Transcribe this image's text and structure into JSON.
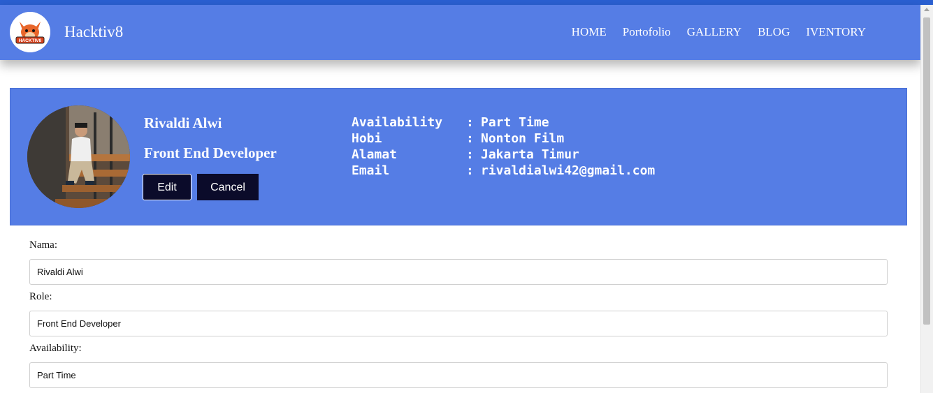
{
  "brand": {
    "name": "Hacktiv8",
    "logo_text": "HACKTIV8"
  },
  "nav": {
    "links": [
      "HOME",
      "Portofolio",
      "GALLERY",
      "BLOG",
      "IVENTORY"
    ]
  },
  "profile": {
    "name": "Rivaldi Alwi",
    "role": "Front End Developer",
    "edit_label": "Edit",
    "cancel_label": "Cancel",
    "details": [
      {
        "label": "Availability",
        "sep": ":",
        "value": "Part Time"
      },
      {
        "label": "Hobi",
        "sep": ":",
        "value": "Nonton Film"
      },
      {
        "label": "Alamat",
        "sep": ":",
        "value": "Jakarta Timur"
      },
      {
        "label": "Email",
        "sep": ":",
        "value": "rivaldialwi42@gmail.com"
      }
    ]
  },
  "form": {
    "fields": [
      {
        "label": "Nama:",
        "value": "Rivaldi Alwi"
      },
      {
        "label": "Role:",
        "value": "Front End Developer"
      },
      {
        "label": "Availability:",
        "value": "Part Time"
      }
    ]
  },
  "colors": {
    "navbar": "#557de5",
    "topline": "#2a5fd0",
    "button": "#0b0b2a",
    "card": "#557de5"
  },
  "icons": {
    "logo": "fox-logo-icon",
    "avatar": "profile-photo"
  }
}
